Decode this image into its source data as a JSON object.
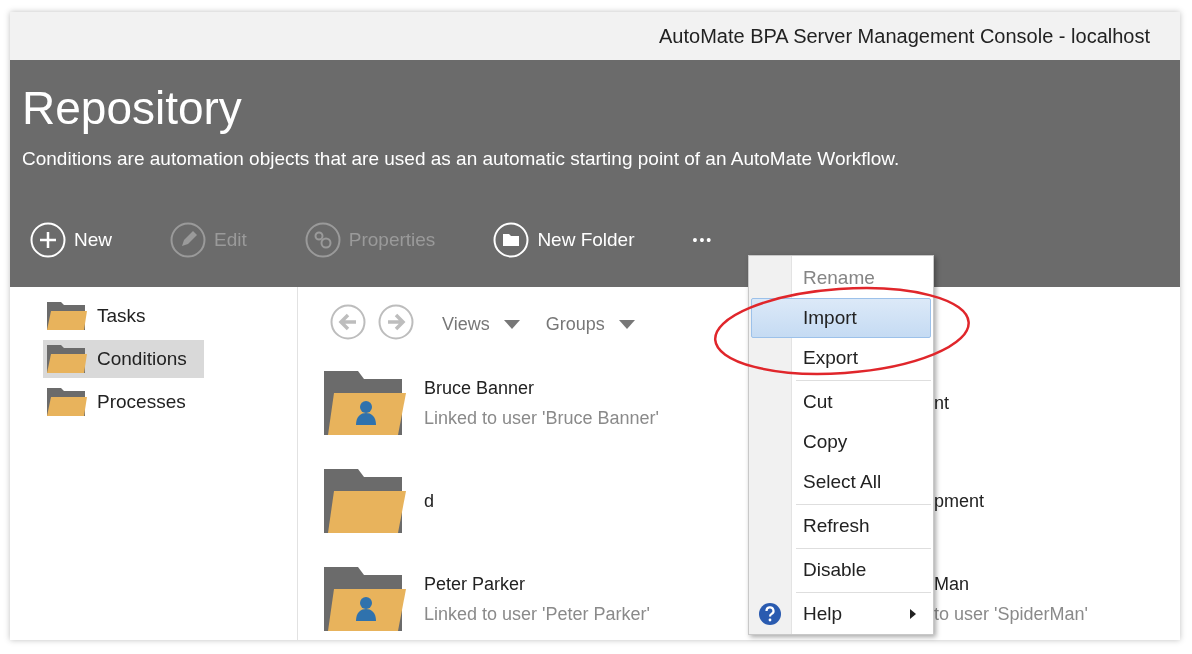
{
  "window": {
    "title": "AutoMate BPA Server Management Console - localhost"
  },
  "header": {
    "title": "Repository",
    "description": "Conditions are automation objects that are used as an automatic starting point of an AutoMate Workflow."
  },
  "toolbar": [
    {
      "kind": "new",
      "label": "New",
      "disabled": false
    },
    {
      "kind": "edit",
      "label": "Edit",
      "disabled": true
    },
    {
      "kind": "properties",
      "label": "Properties",
      "disabled": true
    },
    {
      "kind": "folder",
      "label": "New Folder",
      "disabled": false
    },
    {
      "kind": "more",
      "label": "•••",
      "disabled": false
    }
  ],
  "sidebar": {
    "items": [
      {
        "label": "Tasks",
        "selected": false
      },
      {
        "label": "Conditions",
        "selected": true
      },
      {
        "label": "Processes",
        "selected": false
      }
    ]
  },
  "nav": {
    "back_disabled": true,
    "forward_disabled": true,
    "views": "Views",
    "groups": "Groups"
  },
  "items": [
    {
      "title": "Bruce Banner",
      "subtitle": "Linked to user 'Bruce Banner'",
      "user": true
    },
    {
      "title": "d",
      "user": false
    },
    {
      "title": "Peter Parker",
      "subtitle": "Linked to user 'Peter Parker'",
      "user": true
    }
  ],
  "items_column_2": [
    {
      "title": "nt"
    },
    {
      "title": "pment"
    },
    {
      "title": "Man",
      "subtitle": "to user 'SpiderMan'"
    }
  ],
  "context_menu": [
    {
      "kind": "item",
      "label": "Rename",
      "disabled": true,
      "selected": false
    },
    {
      "kind": "item",
      "label": "Import",
      "disabled": false,
      "selected": true
    },
    {
      "kind": "item",
      "label": "Export",
      "disabled": false,
      "selected": false
    },
    {
      "kind": "separator"
    },
    {
      "kind": "item",
      "label": "Cut",
      "disabled": false,
      "selected": false
    },
    {
      "kind": "item",
      "label": "Copy",
      "disabled": false,
      "selected": false
    },
    {
      "kind": "item",
      "label": "Select All",
      "disabled": false,
      "selected": false
    },
    {
      "kind": "separator"
    },
    {
      "kind": "item",
      "label": "Refresh",
      "disabled": false,
      "selected": false
    },
    {
      "kind": "separator"
    },
    {
      "kind": "item",
      "label": "Disable",
      "disabled": false,
      "selected": false
    },
    {
      "kind": "separator"
    },
    {
      "kind": "help",
      "label": "Help",
      "disabled": false,
      "selected": false,
      "submenu": true
    }
  ]
}
